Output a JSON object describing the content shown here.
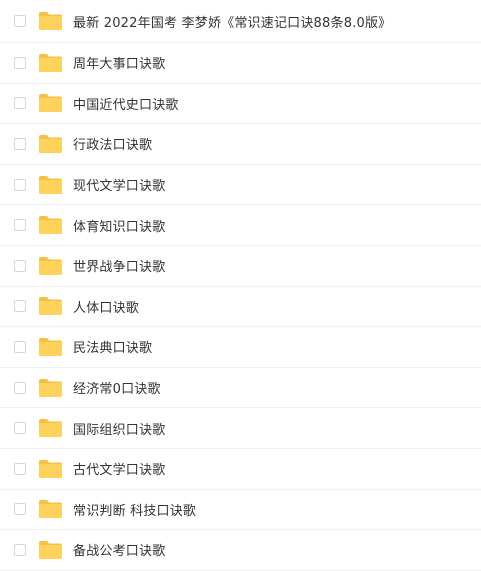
{
  "file_list": {
    "items": [
      {
        "name": "最新 2022年国考 李梦娇《常识速记口诀88条8.0版》",
        "icon": "folder-icon"
      },
      {
        "name": "周年大事口诀歌",
        "icon": "folder-icon"
      },
      {
        "name": "中国近代史口诀歌",
        "icon": "folder-icon"
      },
      {
        "name": "行政法口诀歌",
        "icon": "folder-icon"
      },
      {
        "name": "现代文学口诀歌",
        "icon": "folder-icon"
      },
      {
        "name": "体育知识口诀歌",
        "icon": "folder-icon"
      },
      {
        "name": "世界战争口诀歌",
        "icon": "folder-icon"
      },
      {
        "name": "人体口诀歌",
        "icon": "folder-icon"
      },
      {
        "name": "民法典口诀歌",
        "icon": "folder-icon"
      },
      {
        "name": "经济常0口诀歌",
        "icon": "folder-icon"
      },
      {
        "name": "国际组织口诀歌",
        "icon": "folder-icon"
      },
      {
        "name": "古代文学口诀歌",
        "icon": "folder-icon"
      },
      {
        "name": "常识判断 科技口诀歌",
        "icon": "folder-icon"
      },
      {
        "name": "备战公考口诀歌",
        "icon": "folder-icon"
      }
    ]
  },
  "colors": {
    "folder_fill": "#ffd25c",
    "folder_tab": "#f5c144",
    "text": "#333333",
    "divider": "#eef0f3",
    "checkbox_border": "#d3d6db"
  }
}
